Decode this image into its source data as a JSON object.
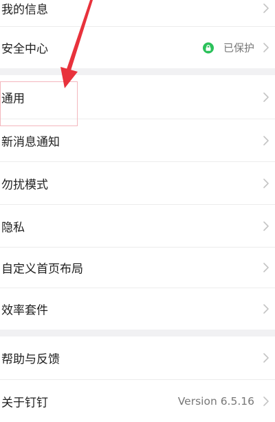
{
  "settings": {
    "items": [
      {
        "label": "我的信息"
      },
      {
        "label": "安全中心",
        "status": "已保护"
      },
      {
        "label": "通用"
      },
      {
        "label": "新消息通知"
      },
      {
        "label": "勿扰模式"
      },
      {
        "label": "隐私"
      },
      {
        "label": "自定义首页布局"
      },
      {
        "label": "效率套件"
      },
      {
        "label": "帮助与反馈"
      },
      {
        "label": "关于钉钉",
        "version": "Version 6.5.16"
      }
    ]
  },
  "colors": {
    "lock_badge": "#2bc15a",
    "annotation_arrow": "#e8323c",
    "section_gap": "#f1f1f3"
  }
}
